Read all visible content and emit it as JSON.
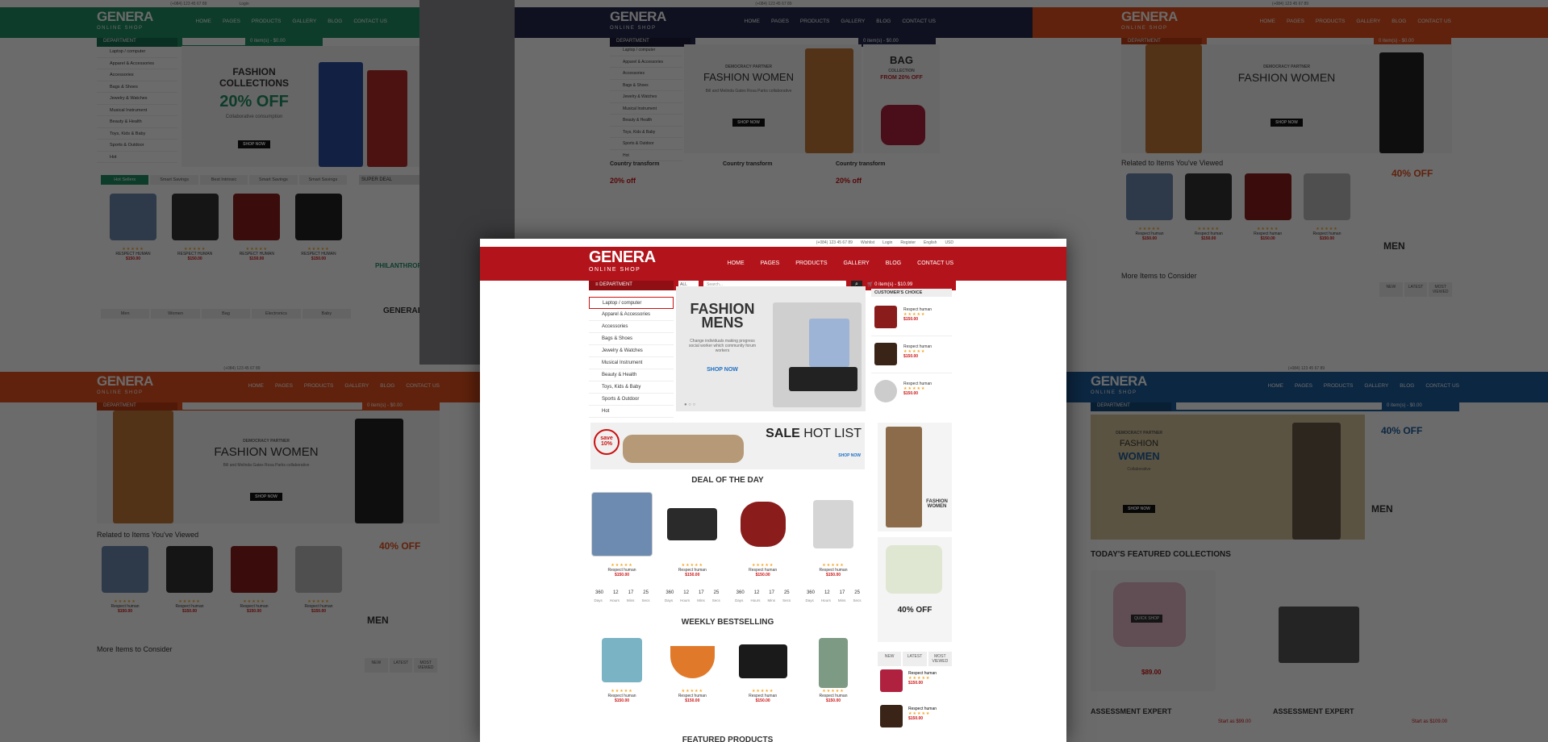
{
  "logo": {
    "name": "GENERA",
    "tagline": "ONLINE SHOP"
  },
  "nav": [
    "HOME",
    "PAGES",
    "PRODUCTS",
    "GALLERY",
    "BLOG",
    "CONTACT US"
  ],
  "department_label": "DEPARTMENT",
  "search_placeholder": "Search...",
  "search_all": "ALL",
  "cart_text": "0 item(s) - $0.00",
  "center_cart_text": "0 item(s) - $10.99",
  "topbar": {
    "phone": "(+084) 123 45 67 89",
    "wishlist": "Wishlist",
    "login": "Login",
    "register": "Register",
    "lang": "English",
    "currency": "USD"
  },
  "categories": [
    "Laptop / computer",
    "Apparel & Accessories",
    "Accessories",
    "Bags & Shoes",
    "Jewelry & Watches",
    "Musical Instrument",
    "Beauty & Health",
    "Toys, Kids & Baby",
    "Sports & Outdoor",
    "Hot"
  ],
  "panel_tl": {
    "banner_title1": "FASHION",
    "banner_title2": "COLLECTIONS",
    "banner_offer": "20% OFF",
    "banner_sub": "Collaborative consumption",
    "banner_btn": "SHOP NOW",
    "tabs": [
      "Hot Sellers",
      "Smart Savings",
      "Best Intrinsic",
      "Smart Savings",
      "Smart Savings"
    ],
    "super_deal": "SUPER DEAL",
    "save": "save 10%",
    "philanthropy": "PHILANTHROPY",
    "cat_tabs": [
      "Men",
      "Women",
      "Bag",
      "Electronics",
      "Baby"
    ],
    "general": "GENERAL",
    "general_sub": "ONLINE SHOP",
    "product_name": "RESPECT HUMAN",
    "price": "$150.00"
  },
  "panel_tm": {
    "kicker": "DEMOCRACY PARTNER",
    "title": "FASHION WOMEN",
    "sub": "Bill and Melinda Gates Rosa Parks collaborative",
    "btn": "SHOP NOW",
    "bag_title": "BAG",
    "bag_sub": "COLLECTION",
    "bag_offer": "FROM 20% OFF",
    "transform": "Country transform",
    "off": "20% off",
    "save": "save 10%"
  },
  "panel_tr": {
    "kicker": "DEMOCRACY PARTNER",
    "title": "FASHION WOMEN",
    "btn": "SHOP NOW",
    "related": "Related to Items You've Viewed",
    "more": "More Items to Consider",
    "off40": "40% OFF",
    "men": "MEN",
    "men_sub": "COLLECTION",
    "from20": "FROM 20% OFF",
    "tabs": [
      "NEW",
      "LATEST",
      "MOST VIEWED"
    ],
    "product": "Respect human",
    "price": "$150.00"
  },
  "panel_bl": {
    "kicker": "DEMOCRACY PARTNER",
    "title": "FASHION WOMEN",
    "sub": "Bill and Melinda Gates Rosa Parks collaborative",
    "btn": "SHOP NOW",
    "related": "Related to Items You've Viewed",
    "more": "More Items to Consider",
    "off40": "40% OFF",
    "men": "MEN",
    "men_sub": "COLLECTION",
    "from20": "FROM 20% OFF",
    "tabs": [
      "NEW",
      "LATEST",
      "MOST VIEWED"
    ],
    "product": "Respect human",
    "price": "$150.00"
  },
  "panel_br": {
    "kicker": "DEMOCRACY PARTNER",
    "title1": "FASHION",
    "title2": "WOMEN",
    "sub": "Collaborative",
    "btn": "SHOP NOW",
    "off40": "40% OFF",
    "men": "MEN",
    "men_sub": "COLLECTION",
    "from20": "FROM 20% OFF",
    "featured": "TODAY'S FEATURED COLLECTIONS",
    "quick": "QUICK SHOP",
    "expert": "ASSESSMENT EXPERT",
    "start1": "Start as $99.00",
    "start2": "Start as $109.00",
    "price": "$89.00"
  },
  "center": {
    "fashion_title1": "FASHION",
    "fashion_title2": "MENS",
    "fashion_sub": "Change individuals making progress social worker which community forum workers",
    "shop_now": "SHOP NOW",
    "customer_choice": "CUSTOMER'S CHOICE",
    "sale": "SALE",
    "hot_list": "HOT LIST",
    "save": "save 10%",
    "shop_now_small": "SHOP NOW",
    "deal_title": "DEAL OF THE DAY",
    "weekly_title": "WEEKLY BESTSELLING",
    "featured_title": "FEATURED PRODUCTS",
    "product": "Respect human",
    "price": "$150.00",
    "countdown": [
      "360",
      "12",
      "17",
      "25"
    ],
    "countdown_labels": [
      "Days",
      "Hours",
      "Mins",
      "Secs"
    ],
    "fashion_women": "FASHION WOMEN",
    "off40": "40% OFF",
    "tabs": [
      "NEW",
      "LATEST",
      "MOST VIEWED"
    ]
  }
}
